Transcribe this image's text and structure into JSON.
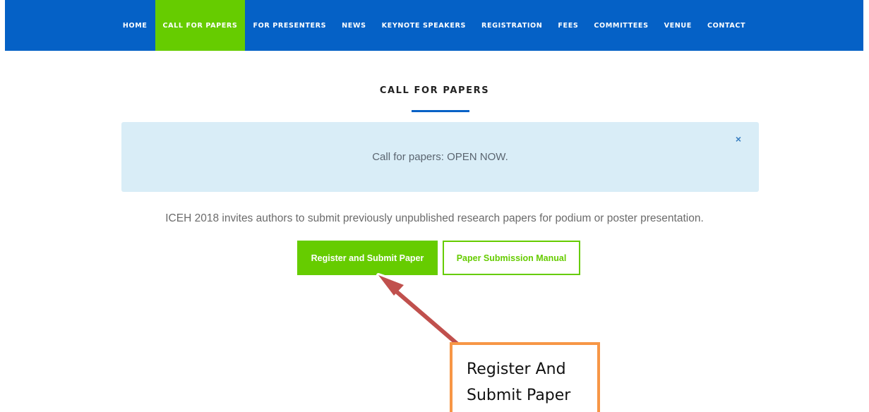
{
  "nav": {
    "items": [
      {
        "label": "HOME",
        "active": false
      },
      {
        "label": "CALL FOR PAPERS",
        "active": true
      },
      {
        "label": "FOR PRESENTERS",
        "active": false
      },
      {
        "label": "NEWS",
        "active": false
      },
      {
        "label": "KEYNOTE SPEAKERS",
        "active": false
      },
      {
        "label": "REGISTRATION",
        "active": false
      },
      {
        "label": "FEES",
        "active": false
      },
      {
        "label": "COMMITTEES",
        "active": false
      },
      {
        "label": "VENUE",
        "active": false
      },
      {
        "label": "CONTACT",
        "active": false
      }
    ]
  },
  "main": {
    "title": "CALL FOR PAPERS",
    "alert": {
      "text": "Call for papers: OPEN NOW.",
      "close_icon": "×"
    },
    "intro": "ICEH 2018 invites authors to submit previously unpublished research papers for podium or poster presentation.",
    "buttons": {
      "register_label": "Register and Submit Paper",
      "manual_label": "Paper Submission Manual"
    }
  },
  "annotation": {
    "callout_line1": "Register And",
    "callout_line2": "Submit Paper"
  },
  "colors": {
    "nav_blue": "#0561c6",
    "accent_green": "#66cc00",
    "alert_bg": "#d9edf7",
    "arrow_red": "#c0504d",
    "callout_orange": "#f79646"
  }
}
